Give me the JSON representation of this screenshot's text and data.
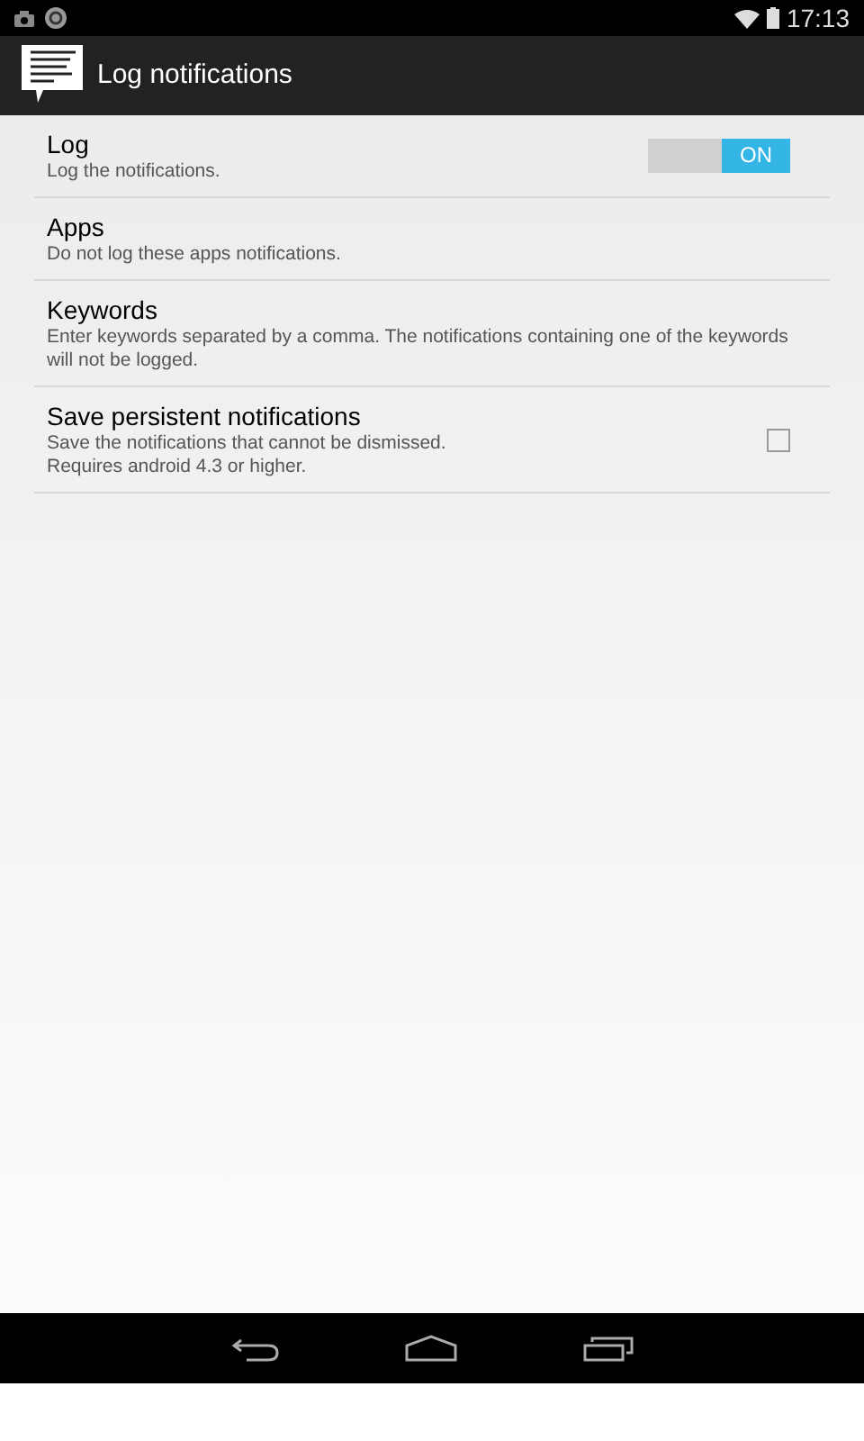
{
  "status_bar": {
    "time": "17:13"
  },
  "action_bar": {
    "title": "Log notifications"
  },
  "settings": [
    {
      "kind": "toggle",
      "title": "Log",
      "summary": "Log the notifications.",
      "on": true,
      "label": "ON"
    },
    {
      "kind": "plain",
      "title": "Apps",
      "summary": "Do not log these apps notifications."
    },
    {
      "kind": "plain",
      "title": "Keywords",
      "summary": "Enter keywords separated by a comma. The notifications containing one of the keywords will not be logged."
    },
    {
      "kind": "checkbox",
      "title": "Save persistent notifications",
      "summary": "Save the notifications that cannot be dismissed.\nRequires android 4.3 or higher.",
      "checked": false
    }
  ]
}
